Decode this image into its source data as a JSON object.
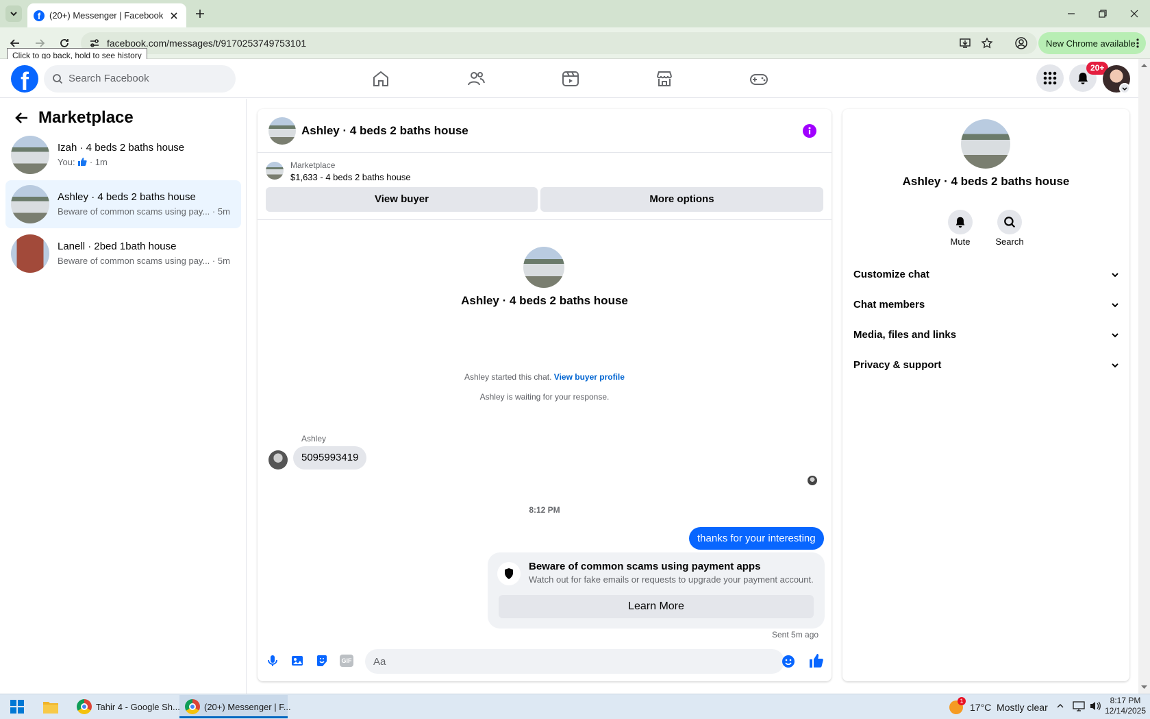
{
  "browser": {
    "tab_title": "(20+) Messenger | Facebook",
    "url": "facebook.com/messages/t/9170253749753101",
    "tooltip": "Click to go back, hold to see history",
    "new_chrome": "New Chrome available"
  },
  "fb": {
    "logo": "f",
    "search_placeholder": "Search Facebook",
    "notification_badge": "20+"
  },
  "sidebar": {
    "title": "Marketplace",
    "conversations": [
      {
        "name": "Izah · 4 beds 2 baths house",
        "preview": "You:",
        "time": "· 1m"
      },
      {
        "name": "Ashley · 4 beds 2 baths house",
        "preview": "Beware of common scams using pay...",
        "time": "· 5m"
      },
      {
        "name": "Lanell · 2bed 1bath house",
        "preview": "Beware of common scams using pay...",
        "time": "· 5m"
      }
    ]
  },
  "chat": {
    "title": "Ashley · 4 beds 2 baths house",
    "listing_source": "Marketplace",
    "listing_info": "$1,633 - 4 beds 2 baths house",
    "view_buyer": "View buyer",
    "more_options": "More options",
    "intro_name": "Ashley · 4 beds 2 baths house",
    "started_text": "Ashley started this chat.",
    "view_profile": "View buyer profile",
    "waiting_text": "Ashley is waiting for your response.",
    "sender_name": "Ashley",
    "incoming_message": "5095993419",
    "timestamp": "8:12 PM",
    "outgoing_message": "thanks for your interesting",
    "scam_title": "Beware of common scams using payment apps",
    "scam_text": "Watch out for fake emails or requests to upgrade your payment account.",
    "learn_more": "Learn More",
    "sent_status": "Sent 5m ago",
    "composer_placeholder": "Aa",
    "gif_label": "GIF"
  },
  "right_panel": {
    "name": "Ashley · 4 beds 2 baths house",
    "mute": "Mute",
    "search": "Search",
    "sections": [
      "Customize chat",
      "Chat members",
      "Media, files and links",
      "Privacy & support"
    ]
  },
  "taskbar": {
    "task1": "Tahir 4 - Google Sh...",
    "task2": "(20+) Messenger | F...",
    "weather": "17°C  Mostly clear",
    "time": "8:17 PM",
    "date": "12/14/2025",
    "weather_badge": "1"
  },
  "colors": {
    "fb_blue": "#0866ff",
    "active_conv": "#ebf5ff",
    "info_purple": "#a100ff"
  }
}
